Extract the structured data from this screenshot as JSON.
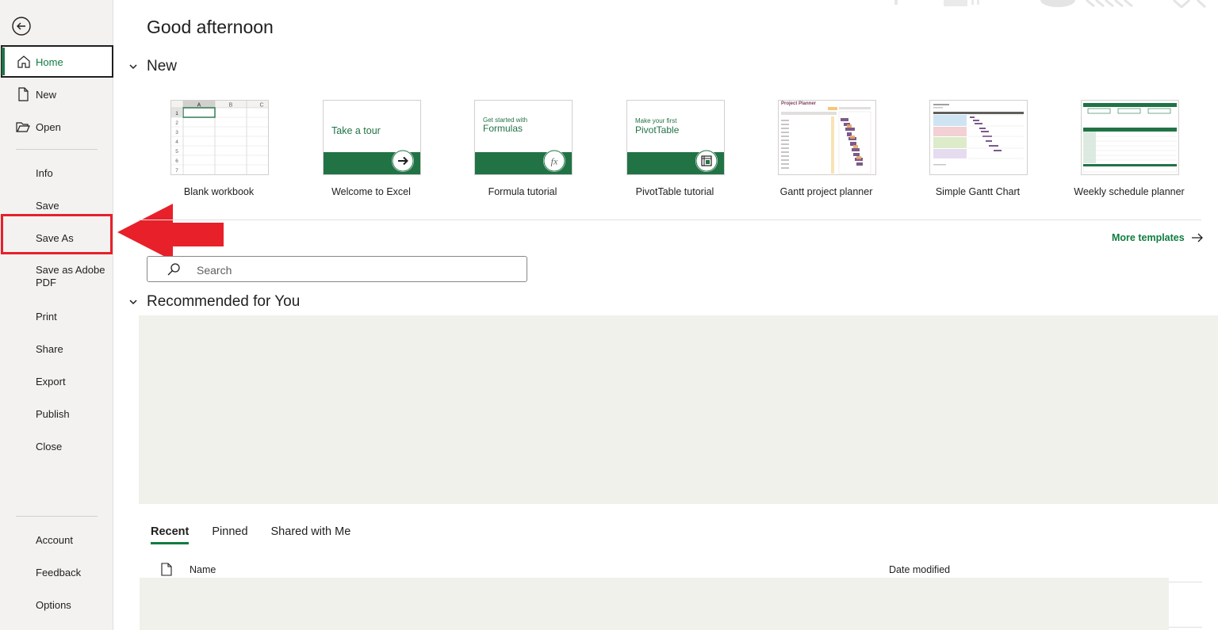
{
  "greeting": "Good afternoon",
  "sidebar": {
    "items": [
      {
        "label": "Home",
        "icon": "home-icon"
      },
      {
        "label": "New",
        "icon": "new-file-icon"
      },
      {
        "label": "Open",
        "icon": "folder-open-icon"
      },
      {
        "label": "Info"
      },
      {
        "label": "Save"
      },
      {
        "label": "Save As"
      },
      {
        "label": "Save as Adobe PDF"
      },
      {
        "label": "Print"
      },
      {
        "label": "Share"
      },
      {
        "label": "Export"
      },
      {
        "label": "Publish"
      },
      {
        "label": "Close"
      },
      {
        "label": "Account"
      },
      {
        "label": "Feedback"
      },
      {
        "label": "Options"
      }
    ]
  },
  "new_section": {
    "title": "New",
    "templates": [
      {
        "label": "Blank workbook"
      },
      {
        "label": "Welcome to Excel",
        "thumb_text": "Take a tour"
      },
      {
        "label": "Formula tutorial",
        "thumb_small": "Get started with",
        "thumb_big": "Formulas"
      },
      {
        "label": "PivotTable tutorial",
        "thumb_small": "Make your first",
        "thumb_big": "PivotTable"
      },
      {
        "label": "Gantt project planner",
        "thumb_text": "Project Planner"
      },
      {
        "label": "Simple Gantt Chart"
      },
      {
        "label": "Weekly schedule planner"
      }
    ],
    "more_templates": "More templates"
  },
  "blank_grid": {
    "columns": [
      "A",
      "B",
      "C"
    ],
    "rows": [
      "1",
      "2",
      "3",
      "4",
      "5",
      "6",
      "7"
    ]
  },
  "search": {
    "placeholder": "Search"
  },
  "recommended": {
    "title": "Recommended for You"
  },
  "file_tabs": [
    "Recent",
    "Pinned",
    "Shared with Me"
  ],
  "file_list": {
    "col_name": "Name",
    "col_date": "Date modified"
  },
  "colors": {
    "accent": "#107c41",
    "excel_green": "#217346",
    "highlight_red": "#e8202a"
  }
}
